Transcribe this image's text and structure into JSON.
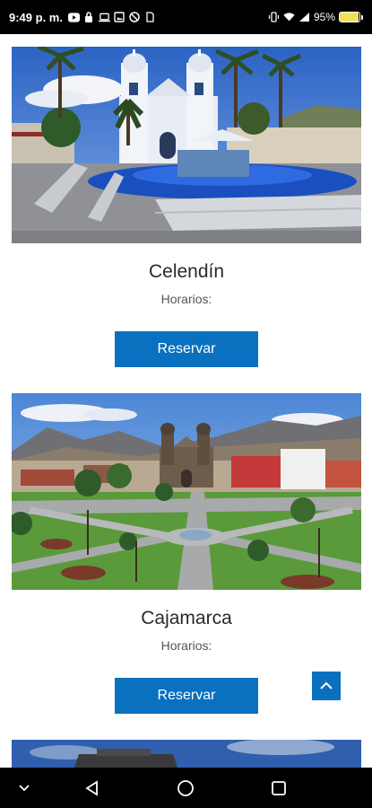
{
  "status_bar": {
    "time": "9:49 p. m.",
    "battery_percent": "95%",
    "battery_level": 0.95,
    "left_icons": [
      "youtube-icon",
      "lock-icon",
      "laptop-icon",
      "gallery-icon",
      "blocked-icon",
      "sim-icon"
    ],
    "right_icons": [
      "vibrate-icon",
      "wifi-icon",
      "signal-icon"
    ]
  },
  "cards": [
    {
      "title": "Celendín",
      "schedule_label": "Horarios:",
      "button_label": "Reservar",
      "image": "celendin-plaza-photo"
    },
    {
      "title": "Cajamarca",
      "schedule_label": "Horarios:",
      "button_label": "Reservar",
      "image": "cajamarca-plaza-photo"
    },
    {
      "image": "next-destination-photo"
    }
  ],
  "scroll_top_icon": "chevron-up-icon",
  "nav_bar": {
    "buttons": [
      "collapse-icon",
      "back-icon",
      "home-icon",
      "recents-icon"
    ]
  },
  "colors": {
    "accent": "#0a70c0",
    "status_bar": "#000000",
    "battery": "#f2e15c"
  }
}
